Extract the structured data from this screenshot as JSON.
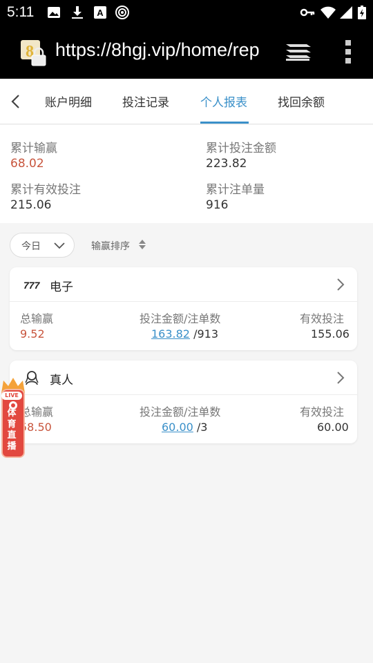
{
  "status_bar": {
    "time": "5:11",
    "icons": [
      "image-icon",
      "download-icon",
      "font-icon",
      "hotspot-icon",
      "key-icon",
      "wifi-icon",
      "signal-icon",
      "battery-icon"
    ]
  },
  "url_bar": {
    "url": "https://8hgj.vip/home/rep"
  },
  "tabs": {
    "items": [
      {
        "label": "账户明细"
      },
      {
        "label": "投注记录"
      },
      {
        "label": "个人报表"
      },
      {
        "label": "找回余额"
      }
    ],
    "active_index": 2
  },
  "summary": {
    "win_loss_label": "累计输赢",
    "win_loss_value": "68.02",
    "bet_amount_label": "累计投注金额",
    "bet_amount_value": "223.82",
    "valid_bet_label": "累计有效投注",
    "valid_bet_value": "215.06",
    "bet_count_label": "累计注单量",
    "bet_count_value": "916"
  },
  "filter": {
    "period": "今日",
    "sort_label": "输赢排序"
  },
  "cards": [
    {
      "title": "电子",
      "total_label": "总输赢",
      "total_value": "9.52",
      "bet_label": "投注金额/注单数",
      "bet_amount": "163.82",
      "bet_count": "/913",
      "valid_label": "有效投注",
      "valid_value": "155.06"
    },
    {
      "title": "真人",
      "total_label": "总输赢",
      "total_value": "58.50",
      "bet_label": "投注金额/注单数",
      "bet_amount": "60.00",
      "bet_count": "/3",
      "valid_label": "有效投注",
      "valid_value": "60.00"
    }
  ],
  "live_badge": {
    "tag": "LIVE",
    "text": "体育直播"
  },
  "colors": {
    "accent": "#3a90c9",
    "negative": "#c8553d",
    "badge": "#e2483f"
  }
}
